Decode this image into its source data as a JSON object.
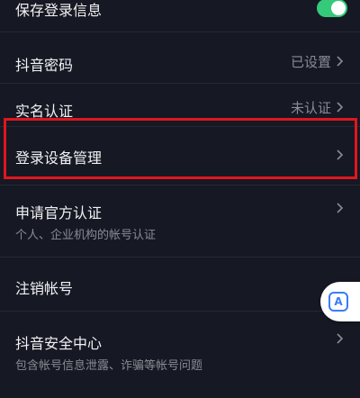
{
  "rows": {
    "save_login": {
      "label": "保存登录信息",
      "toggle_on": true
    },
    "password": {
      "label": "抖音密码",
      "value": "已设置"
    },
    "realname": {
      "label": "实名认证",
      "value": "未认证"
    },
    "devices": {
      "label": "登录设备管理"
    },
    "official": {
      "label": "申请官方认证",
      "sub": "个人、企业机构的帐号认证"
    },
    "cancel": {
      "label": "注销帐号"
    },
    "security": {
      "label": "抖音安全中心",
      "sub": "包含帐号信息泄露、诈骗等帐号问题"
    }
  },
  "float_button": {
    "glyph": "A",
    "icon": "translate-icon"
  },
  "colors": {
    "background": "#161823",
    "toggle_on": "#35c97a",
    "highlight": "#e0161f",
    "float_accent": "#3b7cf6"
  }
}
